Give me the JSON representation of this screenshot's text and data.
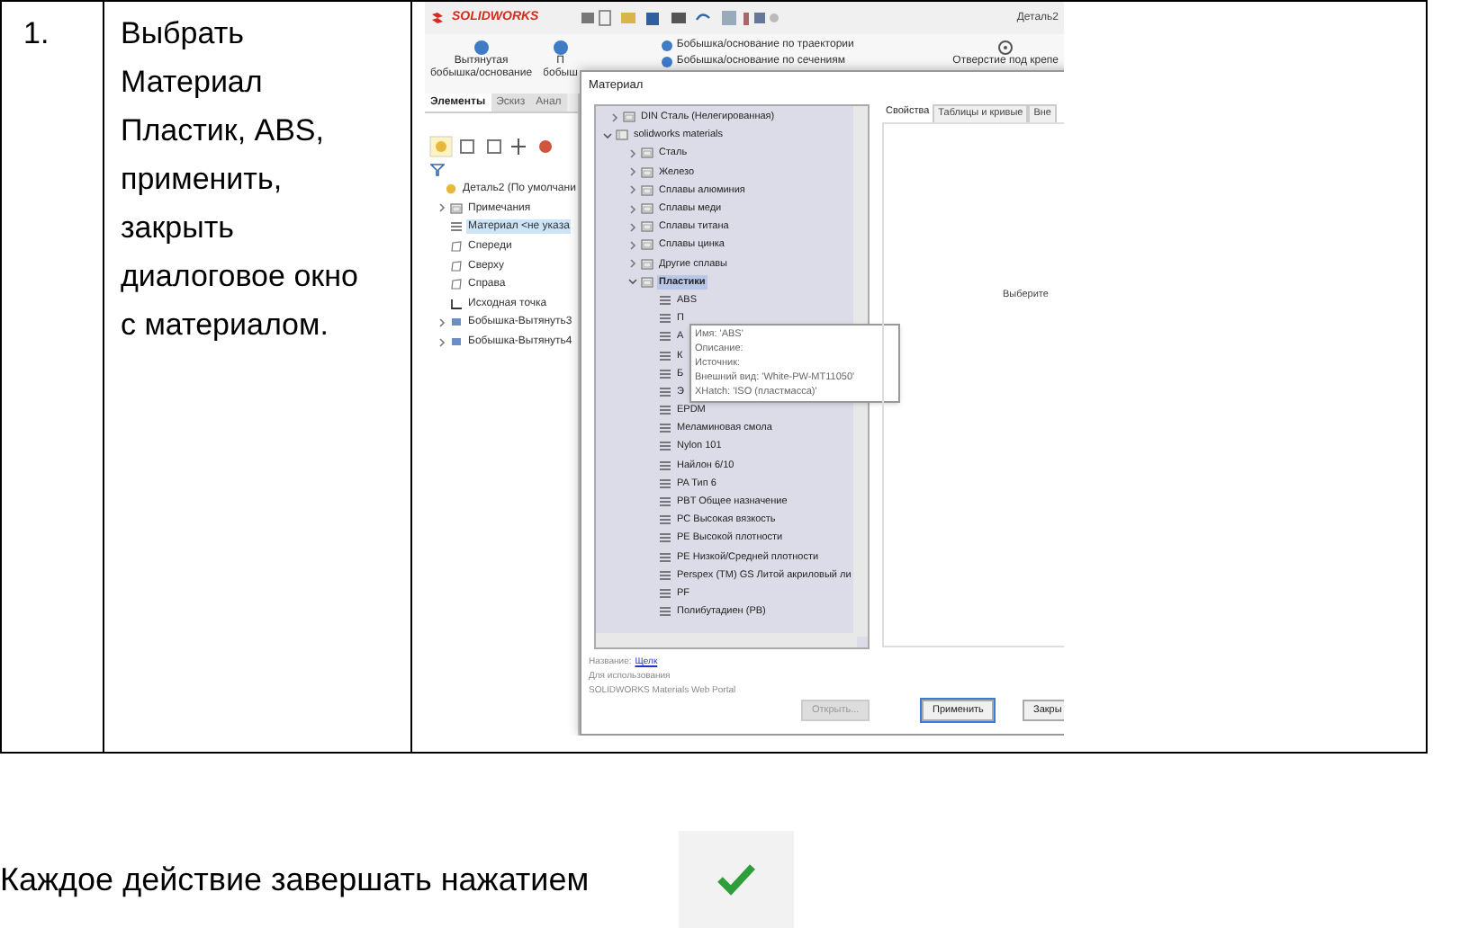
{
  "table": {
    "rows": [
      {
        "number": "1.",
        "instruction": "Выбрать Материал Пластик, ABS, применить, закрыть диалоговое окно с материалом."
      }
    ]
  },
  "screenshot": {
    "logo": "SOLIDWORKS",
    "document_title": "Деталь2",
    "ribbon": {
      "large_buttons": [
        {
          "lines": [
            "Вытянутая",
            "бобышка/основание"
          ]
        },
        {
          "lines": [
            "П",
            "бобыш"
          ]
        }
      ],
      "small_buttons": [
        "Бобышка/основание по траектории",
        "Бобышка/основание по сечениям"
      ],
      "right_button": "Отверстие под крепе"
    },
    "panel_tabs": [
      {
        "label": "Элементы",
        "selected": true
      },
      {
        "label": "Эскиз",
        "selected": false
      },
      {
        "label": "Анал",
        "selected": false
      }
    ],
    "feature_tree": [
      {
        "label": "Деталь2  (По умолчани",
        "kind": "part",
        "selected": false,
        "children": [
          {
            "label": "Примечания",
            "kind": "folder",
            "expanded": false,
            "selected": false
          },
          {
            "label": "Материал <не указа",
            "kind": "material",
            "selected": true
          },
          {
            "label": "Спереди",
            "kind": "plane",
            "selected": false
          },
          {
            "label": "Сверху",
            "kind": "plane",
            "selected": false
          },
          {
            "label": "Справа",
            "kind": "plane",
            "selected": false
          },
          {
            "label": "Исходная точка",
            "kind": "origin",
            "selected": false
          },
          {
            "label": "Бобышка-Вытянуть3",
            "kind": "feature",
            "expanded": false,
            "selected": false
          },
          {
            "label": "Бобышка-Вытянуть4",
            "kind": "feature",
            "expanded": false,
            "selected": false
          }
        ]
      }
    ],
    "dialog": {
      "title": "Материал",
      "tree": [
        {
          "label": "DIN Сталь (Нелегированная)",
          "kind": "folder",
          "expanded": false,
          "selected": false
        },
        {
          "label": "solidworks materials",
          "kind": "library",
          "expanded": true,
          "selected": false,
          "children": [
            {
              "label": "Сталь",
              "kind": "folder",
              "expanded": false,
              "selected": false
            },
            {
              "label": "Железо",
              "kind": "folder",
              "expanded": false,
              "selected": false
            },
            {
              "label": "Сплавы алюминия",
              "kind": "folder",
              "expanded": false,
              "selected": false
            },
            {
              "label": "Сплавы меди",
              "kind": "folder",
              "expanded": false,
              "selected": false
            },
            {
              "label": "Сплавы титана",
              "kind": "folder",
              "expanded": false,
              "selected": false
            },
            {
              "label": "Сплавы цинка",
              "kind": "folder",
              "expanded": false,
              "selected": false
            },
            {
              "label": "Другие сплавы",
              "kind": "folder",
              "expanded": false,
              "selected": false
            },
            {
              "label": "Пластики",
              "kind": "folder",
              "expanded": true,
              "selected": true,
              "children": [
                {
                  "label": "ABS",
                  "kind": "material",
                  "selected": false
                },
                {
                  "label": "П",
                  "kind": "material",
                  "selected": false
                },
                {
                  "label": "А",
                  "kind": "material",
                  "selected": false
                },
                {
                  "label": "К",
                  "kind": "material",
                  "selected": false
                },
                {
                  "label": "Б",
                  "kind": "material",
                  "selected": false
                },
                {
                  "label": "Э",
                  "kind": "material",
                  "selected": false
                },
                {
                  "label": "EPDM",
                  "kind": "material",
                  "selected": false
                },
                {
                  "label": "Меламиновая смола",
                  "kind": "material",
                  "selected": false
                },
                {
                  "label": "Nylon 101",
                  "kind": "material",
                  "selected": false
                },
                {
                  "label": "Найлон 6/10",
                  "kind": "material",
                  "selected": false
                },
                {
                  "label": "PA Тип 6",
                  "kind": "material",
                  "selected": false
                },
                {
                  "label": "PBT Общее назначение",
                  "kind": "material",
                  "selected": false
                },
                {
                  "label": "PC Высокая вязкость",
                  "kind": "material",
                  "selected": false
                },
                {
                  "label": "PE Высокой плотности",
                  "kind": "material",
                  "selected": false
                },
                {
                  "label": "PE Низкой/Средней плотности",
                  "kind": "material",
                  "selected": false
                },
                {
                  "label": "Perspex (TM) GS Литой акриловый ли",
                  "kind": "material",
                  "selected": false
                },
                {
                  "label": "PF",
                  "kind": "material",
                  "selected": false
                },
                {
                  "label": "Полибутадиен (PB)",
                  "kind": "material",
                  "selected": false
                }
              ]
            }
          ]
        }
      ],
      "tooltip": [
        "Имя: 'ABS'",
        "Описание:",
        "Источник:",
        "Внешний вид: 'White-PW-MT11050'",
        "XHatch: 'ISO (пластмасса)'"
      ],
      "tabs": [
        {
          "label": "Свойства",
          "selected": true
        },
        {
          "label": "Таблицы и кривые",
          "selected": false
        },
        {
          "label": "Вне",
          "selected": false
        }
      ],
      "hint": "Выберите",
      "name_label": "Название:",
      "name_link": "Щелк",
      "usage_label": "Для использования",
      "portal": "SOLIDWORKS Materials Web Portal",
      "buttons": [
        {
          "label": "Открыть...",
          "disabled": true,
          "focused": false
        },
        {
          "label": "Применить",
          "disabled": false,
          "focused": true
        },
        {
          "label": "Закры",
          "disabled": false,
          "focused": false
        }
      ]
    }
  },
  "footer": {
    "text": "Каждое действие завершать нажатием"
  }
}
